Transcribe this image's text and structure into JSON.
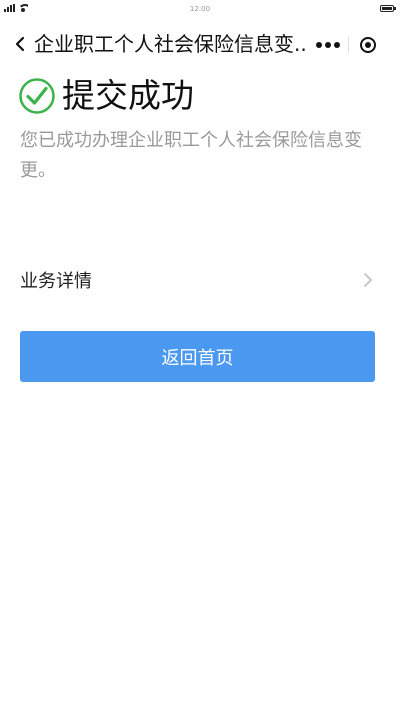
{
  "status_bar": {
    "time": "12:00"
  },
  "nav": {
    "title": "企业职工个人社会保险信息变...",
    "back_icon": "chevron-left-icon",
    "more_icon": "more-dots-icon",
    "close_icon": "target-close-icon"
  },
  "result": {
    "icon": "check-circle-icon",
    "icon_color": "#3bb34a",
    "title": "提交成功",
    "description": "您已成功办理企业职工个人社会保险信息变更。"
  },
  "detail_row": {
    "label": "业务详情",
    "icon": "chevron-right-icon"
  },
  "actions": {
    "home_label": "返回首页",
    "home_color": "#4a98f0"
  }
}
